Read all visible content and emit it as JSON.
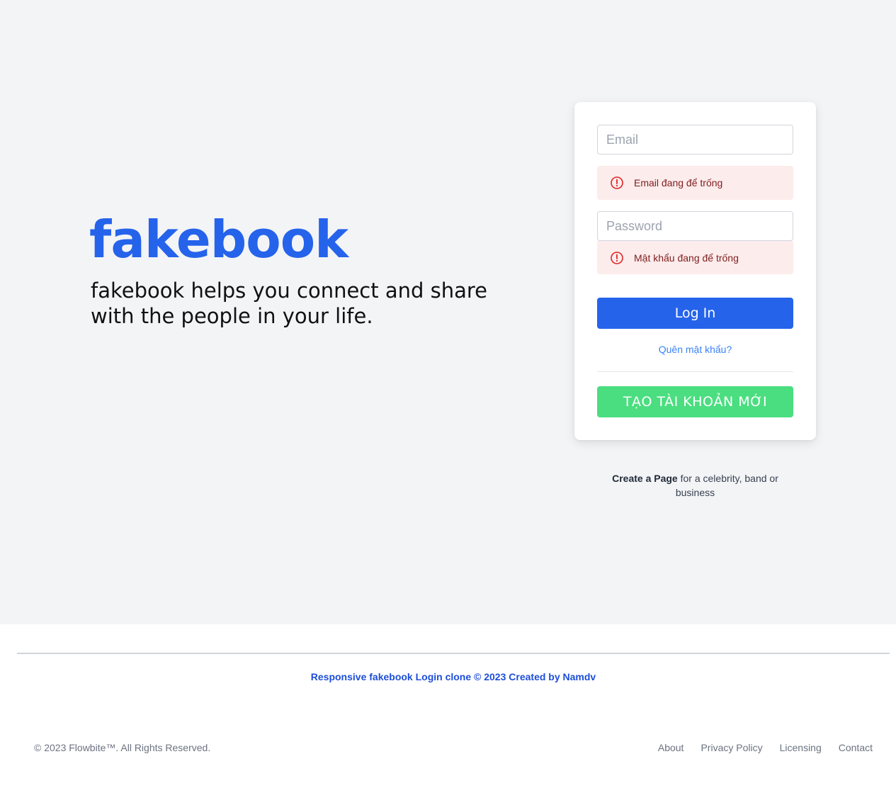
{
  "hero": {
    "brand": "fakebook",
    "tagline": "fakebook helps you connect and share with the people in your life."
  },
  "login_form": {
    "email_placeholder": "Email",
    "email_error": "Email đang để trống",
    "password_placeholder": "Password",
    "password_error": "Mật khẩu đang để trống",
    "login_label": "Log In",
    "forgot_label": "Quên mật khẩu?",
    "create_account_label": "TẠO TÀI KHOẢN MỚI"
  },
  "create_page": {
    "bold_text": "Create a Page",
    "rest_text": " for a celebrity, band or business"
  },
  "footer": {
    "credit": "Responsive fakebook Login clone © 2023 Created by Namdv",
    "copyright": "© 2023 Flowbite™. All Rights Reserved.",
    "links": [
      "About",
      "Privacy Policy",
      "Licensing",
      "Contact"
    ]
  },
  "colors": {
    "brand": "#2563eb",
    "create_button": "#4ade80",
    "error_bg": "#fdecec",
    "error_icon": "#dc2626",
    "background": "#f3f4f6"
  },
  "icons": {
    "alert": "exclamation-circle-icon"
  }
}
